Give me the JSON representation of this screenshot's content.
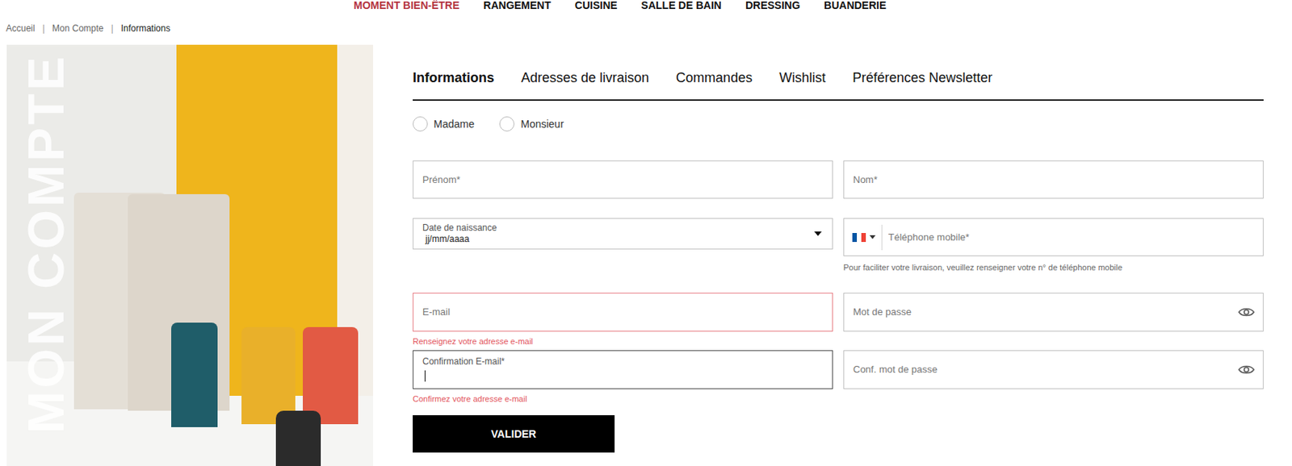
{
  "nav": [
    {
      "label": "MOMENT BIEN-ÊTRE",
      "selected": true
    },
    {
      "label": "RANGEMENT",
      "selected": false
    },
    {
      "label": "CUISINE",
      "selected": false
    },
    {
      "label": "SALLE DE BAIN",
      "selected": false
    },
    {
      "label": "DRESSING",
      "selected": false
    },
    {
      "label": "BUANDERIE",
      "selected": false
    }
  ],
  "breadcrumb": {
    "separator": "|",
    "items": [
      "Accueil",
      "Mon Compte",
      "Informations"
    ]
  },
  "hero": {
    "title": "MON COMPTE"
  },
  "tabs": [
    {
      "label": "Informations",
      "selected": true
    },
    {
      "label": "Adresses de livraison",
      "selected": false
    },
    {
      "label": "Commandes",
      "selected": false
    },
    {
      "label": "Wishlist",
      "selected": false
    },
    {
      "label": "Préférences Newsletter",
      "selected": false
    }
  ],
  "civility": [
    {
      "label": "Madame",
      "selected": false
    },
    {
      "label": "Monsieur",
      "selected": false
    }
  ],
  "form": {
    "first_name": {
      "placeholder": "Prénom*"
    },
    "last_name": {
      "placeholder": "Nom*"
    },
    "birth_date": {
      "label": "Date de naissance",
      "value": "jj/mm/aaaa"
    },
    "phone": {
      "placeholder": "Téléphone mobile*",
      "help": "Pour faciliter votre livraison, veuillez renseigner votre n° de téléphone mobile"
    },
    "email": {
      "placeholder": "E-mail",
      "invalid": true,
      "error": "Renseignez votre adresse e-mail"
    },
    "email_confirm": {
      "label": "Confirmation E-mail*",
      "focused": true,
      "invalid": true,
      "error": "Confirmez votre adresse e-mail"
    },
    "password": {
      "placeholder": "Mot de passe"
    },
    "password_confirm": {
      "placeholder": "Conf. mot de passe"
    }
  },
  "submit": "VALIDER"
}
